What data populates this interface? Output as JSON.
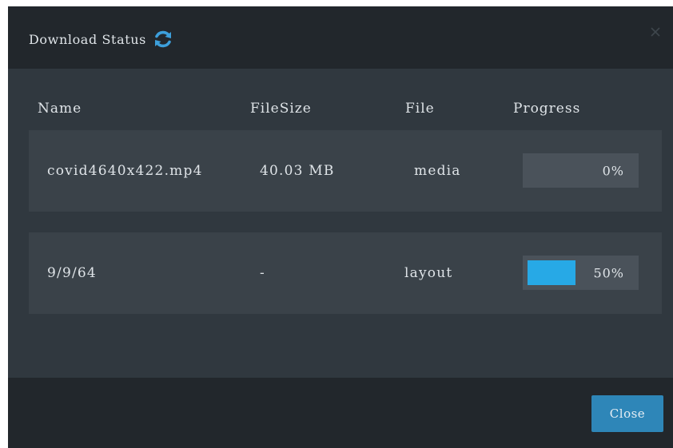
{
  "dialog": {
    "title": "Download Status",
    "close_label": "Close",
    "accent_color": "#27a9e6",
    "close_button_color": "#2e86b8"
  },
  "table": {
    "columns": [
      "Name",
      "FileSize",
      "File",
      "Progress"
    ],
    "rows": [
      {
        "name": "covid4640x422.mp4",
        "filesize": "40.03 MB",
        "file": "media",
        "progress": 0,
        "progress_label": "0%"
      },
      {
        "name": "9/9/64",
        "filesize": "-",
        "file": "layout",
        "progress": 50,
        "progress_label": "50%"
      }
    ]
  }
}
